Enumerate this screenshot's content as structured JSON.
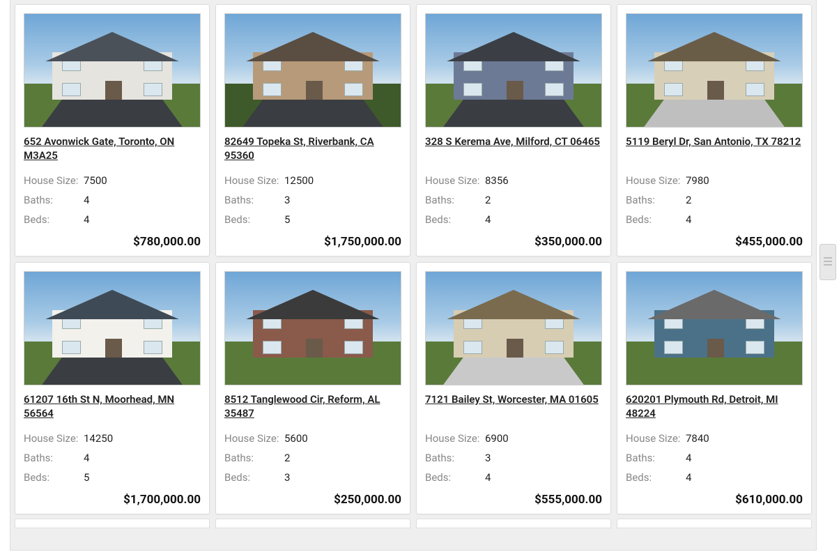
{
  "labels": {
    "house_size": "House Size:",
    "baths": "Baths:",
    "beds": "Beds:"
  },
  "listings": [
    {
      "address": "652 Avonwick Gate, Toronto, ON M3A25",
      "house_size": "7500",
      "baths": "4",
      "beds": "4",
      "price": "$780,000.00"
    },
    {
      "address": "82649 Topeka St, Riverbank, CA 95360",
      "house_size": "12500",
      "baths": "3",
      "beds": "5",
      "price": "$1,750,000.00"
    },
    {
      "address": "328 S Kerema Ave, Milford, CT 06465",
      "house_size": "8356",
      "baths": "2",
      "beds": "4",
      "price": "$350,000.00"
    },
    {
      "address": "5119 Beryl Dr, San Antonio, TX 78212",
      "house_size": "7980",
      "baths": "2",
      "beds": "4",
      "price": "$455,000.00"
    },
    {
      "address": "61207 16th St N, Moorhead, MN 56564",
      "house_size": "14250",
      "baths": "4",
      "beds": "5",
      "price": "$1,700,000.00"
    },
    {
      "address": "8512 Tanglewood Cir, Reform, AL 35487",
      "house_size": "5600",
      "baths": "2",
      "beds": "3",
      "price": "$250,000.00"
    },
    {
      "address": "7121 Bailey St, Worcester, MA 01605",
      "house_size": "6900",
      "baths": "3",
      "beds": "4",
      "price": "$555,000.00"
    },
    {
      "address": "620201 Plymouth Rd, Detroit, MI 48224",
      "house_size": "7840",
      "baths": "4",
      "beds": "4",
      "price": "$610,000.00"
    }
  ]
}
